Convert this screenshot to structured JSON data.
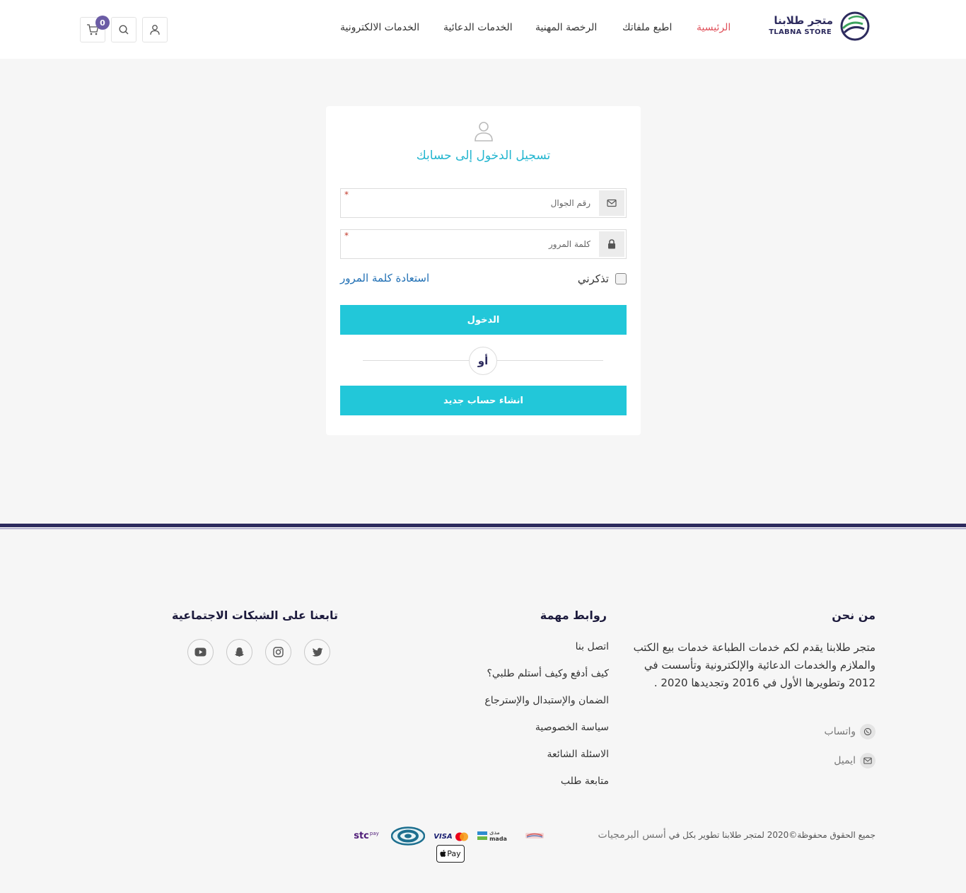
{
  "header": {
    "logo": {
      "name_ar": "متجر طلابنا",
      "name_en": "TLABNA STORE"
    },
    "nav": [
      {
        "label": "الرئيسية",
        "active": true
      },
      {
        "label": "اطبع ملفاتك",
        "active": false
      },
      {
        "label": "الرخصة المهنية",
        "active": false
      },
      {
        "label": "الخدمات الدعائية",
        "active": false
      },
      {
        "label": "الخدمات الالكترونية",
        "active": false
      }
    ],
    "icons": {
      "account": "user-icon",
      "search": "search-icon",
      "cart": "cart-icon"
    },
    "cart_count": "0"
  },
  "login": {
    "icon": "user-outline-icon",
    "title": "تسجيل الدخول إلى حسابك",
    "phone_placeholder": "رقم الجوال",
    "password_placeholder": "كلمة المرور",
    "required_mark": "*",
    "remember_label": "تذكرني",
    "forgot_label": "استعادة كلمة المرور",
    "login_button": "الدخول",
    "or_label": "أو",
    "register_button": "انشاء حساب جديد"
  },
  "footer": {
    "about": {
      "heading": "من نحن",
      "text": "متجر طلابنا يقدم لكم خدمات الطباعة خدمات بيع الكتب والملازم والخدمات الدعائية والإلكترونية وتأسست في 2012 وتطويرها الأول في 2016 وتجديدها 2020 .",
      "whatsapp": "واتساب",
      "email": "ايميل"
    },
    "links": {
      "heading": "روابط مهمة",
      "items": [
        "اتصل بنا",
        "كيف أدفع وكيف أستلم طلبي؟",
        "الضمان والإستبدال والإسترجاع",
        "سياسة الخصوصية",
        "الاسئلة الشائعة",
        "متابعة طلب"
      ]
    },
    "social": {
      "heading": "تابعنا على الشبكات الاجتماعية",
      "icons": [
        "twitter-icon",
        "instagram-icon",
        "snapchat-icon",
        "youtube-icon"
      ]
    },
    "copyright_main": "جميع الحقوق محفوظة©2020 لمتجر طلابنا تطوير بكل في",
    "copyright_company": "أسس البرمجيات",
    "payments": {
      "stc_main": "stc",
      "stc_sub": "pay",
      "visa": "VISA",
      "mada_ar": "مدى",
      "mada_en": "mada",
      "apple_pay": "Pay"
    }
  },
  "colors": {
    "accent": "#22c7d9",
    "nav_active": "#e0505a",
    "brand": "#2d2b5e",
    "title": "#22b5cf",
    "link": "#1f6fb4"
  }
}
